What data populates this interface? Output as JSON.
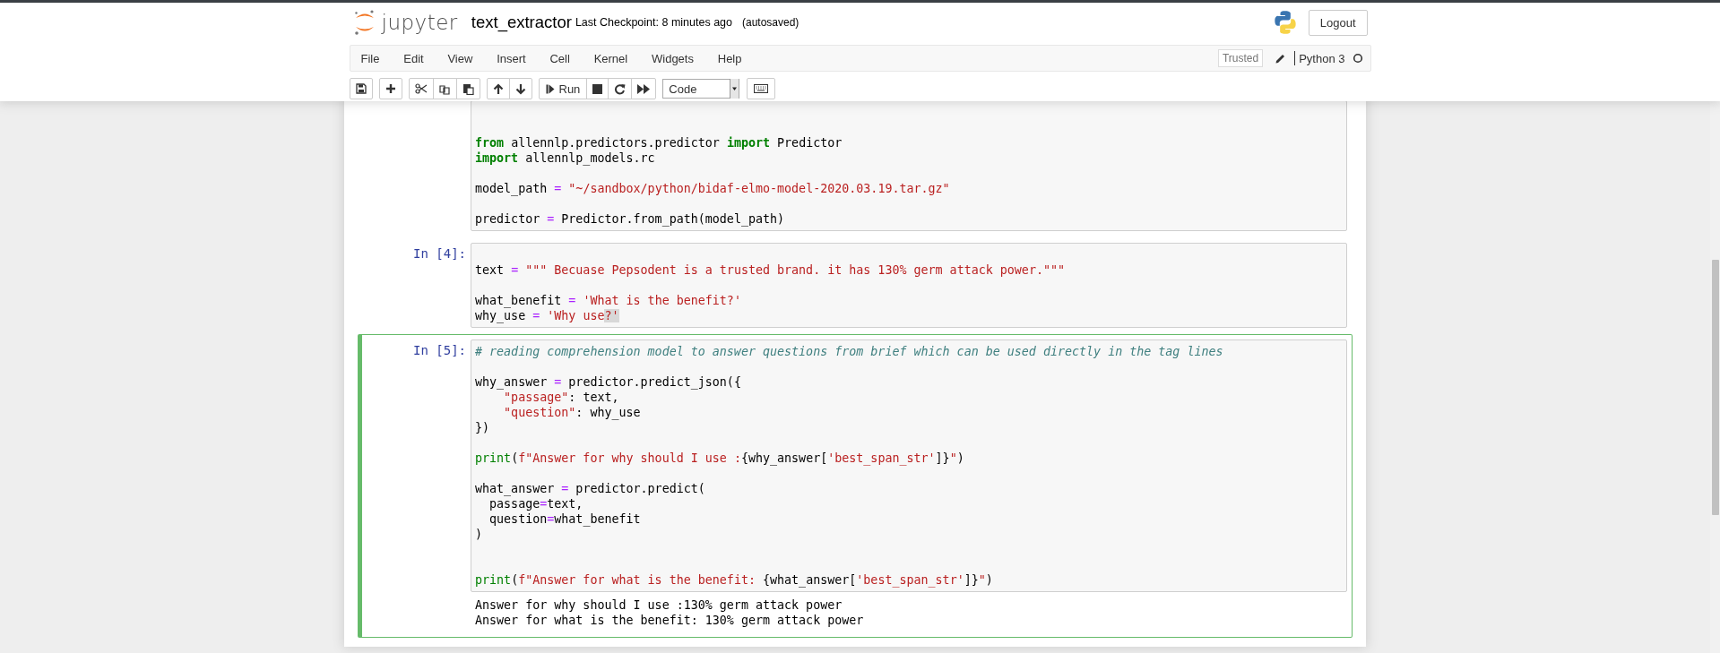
{
  "header": {
    "logo_text": "jupyter",
    "notebook_name": "text_extractor",
    "checkpoint": "Last Checkpoint: 8 minutes ago",
    "autosave_status": "(autosaved)",
    "logout_button": "Logout"
  },
  "menu": [
    "File",
    "Edit",
    "View",
    "Insert",
    "Cell",
    "Kernel",
    "Widgets",
    "Help"
  ],
  "trusted_badge": "Trusted",
  "kernel": {
    "name": "Python 3",
    "busy": false
  },
  "toolbar": {
    "run_label": "Run",
    "cell_type": "Code"
  },
  "cells": [
    {
      "selected": false,
      "cut_top": true,
      "lines": [
        {
          "kind": "blank"
        },
        {
          "kind": "blank"
        },
        {
          "kind": "code",
          "tokens": [
            {
              "kind": "keyword",
              "text": "from"
            },
            {
              "kind": "plain",
              "text": " allennlp.predictors.predictor "
            },
            {
              "kind": "keyword",
              "text": "import"
            },
            {
              "kind": "plain",
              "text": " Predictor"
            }
          ]
        },
        {
          "kind": "code",
          "tokens": [
            {
              "kind": "keyword",
              "text": "import"
            },
            {
              "kind": "plain",
              "text": " allennlp_models.rc"
            }
          ]
        },
        {
          "kind": "blank"
        },
        {
          "kind": "code",
          "tokens": [
            {
              "kind": "plain",
              "text": "model_path "
            },
            {
              "kind": "operator",
              "text": "="
            },
            {
              "kind": "string",
              "text": " \"~/sandbox/python/bidaf-elmo-model-2020.03.19.tar.gz\""
            }
          ]
        },
        {
          "kind": "blank"
        },
        {
          "kind": "code",
          "tokens": [
            {
              "kind": "plain",
              "text": "predictor "
            },
            {
              "kind": "operator",
              "text": "="
            },
            {
              "kind": "plain",
              "text": " Predictor.from_path(model_path)"
            }
          ]
        }
      ]
    },
    {
      "selected": false,
      "cut_top": false,
      "prompt": "In [4]:",
      "lines": [
        {
          "kind": "blank"
        },
        {
          "kind": "code",
          "tokens": [
            {
              "kind": "plain",
              "text": "text "
            },
            {
              "kind": "operator",
              "text": "="
            },
            {
              "kind": "string",
              "text": " \"\"\" Becuase Pepsodent is a trusted brand. it has 130% germ attack power.\"\"\""
            }
          ]
        },
        {
          "kind": "blank"
        },
        {
          "kind": "code",
          "tokens": [
            {
              "kind": "plain",
              "text": "what_benefit "
            },
            {
              "kind": "operator",
              "text": "="
            },
            {
              "kind": "string",
              "text": " 'What is the benefit?'"
            }
          ]
        },
        {
          "kind": "code",
          "tokens": [
            {
              "kind": "plain",
              "text": "why_use "
            },
            {
              "kind": "operator",
              "text": "="
            },
            {
              "kind": "string",
              "text": " 'Why use"
            },
            {
              "kind": "match",
              "text": "?'"
            }
          ]
        }
      ]
    },
    {
      "selected": true,
      "cut_top": false,
      "prompt": "In [5]:",
      "lines": [
        {
          "kind": "code",
          "tokens": [
            {
              "kind": "comment",
              "text": "# reading comprehension model to answer questions from brief which can be used directly in the tag lines"
            }
          ]
        },
        {
          "kind": "blank"
        },
        {
          "kind": "code",
          "tokens": [
            {
              "kind": "plain",
              "text": "why_answer "
            },
            {
              "kind": "operator",
              "text": "="
            },
            {
              "kind": "plain",
              "text": " predictor.predict_json({"
            }
          ]
        },
        {
          "kind": "code",
          "tokens": [
            {
              "kind": "string",
              "text": "    \"passage\""
            },
            {
              "kind": "plain",
              "text": ": text,"
            }
          ]
        },
        {
          "kind": "code",
          "tokens": [
            {
              "kind": "string",
              "text": "    \"question\""
            },
            {
              "kind": "plain",
              "text": ": why_use"
            }
          ]
        },
        {
          "kind": "code",
          "tokens": [
            {
              "kind": "plain",
              "text": "})"
            }
          ]
        },
        {
          "kind": "blank"
        },
        {
          "kind": "code",
          "tokens": [
            {
              "kind": "builtin",
              "text": "print"
            },
            {
              "kind": "plain",
              "text": "("
            },
            {
              "kind": "string",
              "text": "f\"Answer for why should I use :"
            },
            {
              "kind": "plain",
              "text": "{why_answer["
            },
            {
              "kind": "string",
              "text": "'best_span_str'"
            },
            {
              "kind": "plain",
              "text": "]}"
            },
            {
              "kind": "string",
              "text": "\""
            },
            {
              "kind": "plain",
              "text": ")"
            }
          ]
        },
        {
          "kind": "blank"
        },
        {
          "kind": "code",
          "tokens": [
            {
              "kind": "plain",
              "text": "what_answer "
            },
            {
              "kind": "operator",
              "text": "="
            },
            {
              "kind": "plain",
              "text": " predictor.predict("
            }
          ]
        },
        {
          "kind": "code",
          "tokens": [
            {
              "kind": "plain",
              "text": "  passage"
            },
            {
              "kind": "operator",
              "text": "="
            },
            {
              "kind": "plain",
              "text": "text,"
            }
          ]
        },
        {
          "kind": "code",
          "tokens": [
            {
              "kind": "plain",
              "text": "  question"
            },
            {
              "kind": "operator",
              "text": "="
            },
            {
              "kind": "plain",
              "text": "what_benefit"
            }
          ]
        },
        {
          "kind": "code",
          "tokens": [
            {
              "kind": "plain",
              "text": ")"
            }
          ]
        },
        {
          "kind": "blank"
        },
        {
          "kind": "blank"
        },
        {
          "kind": "code",
          "tokens": [
            {
              "kind": "builtin",
              "text": "print"
            },
            {
              "kind": "plain",
              "text": "("
            },
            {
              "kind": "string",
              "text": "f\"Answer for what is the benefit: "
            },
            {
              "kind": "plain",
              "text": "{what_answer["
            },
            {
              "kind": "string",
              "text": "'best_span_str'"
            },
            {
              "kind": "plain",
              "text": "]}"
            },
            {
              "kind": "string",
              "text": "\""
            },
            {
              "kind": "plain",
              "text": ")"
            }
          ]
        }
      ],
      "output": [
        "Answer for why should I use :130% germ attack power",
        "Answer for what is the benefit: 130% germ attack power"
      ]
    }
  ]
}
